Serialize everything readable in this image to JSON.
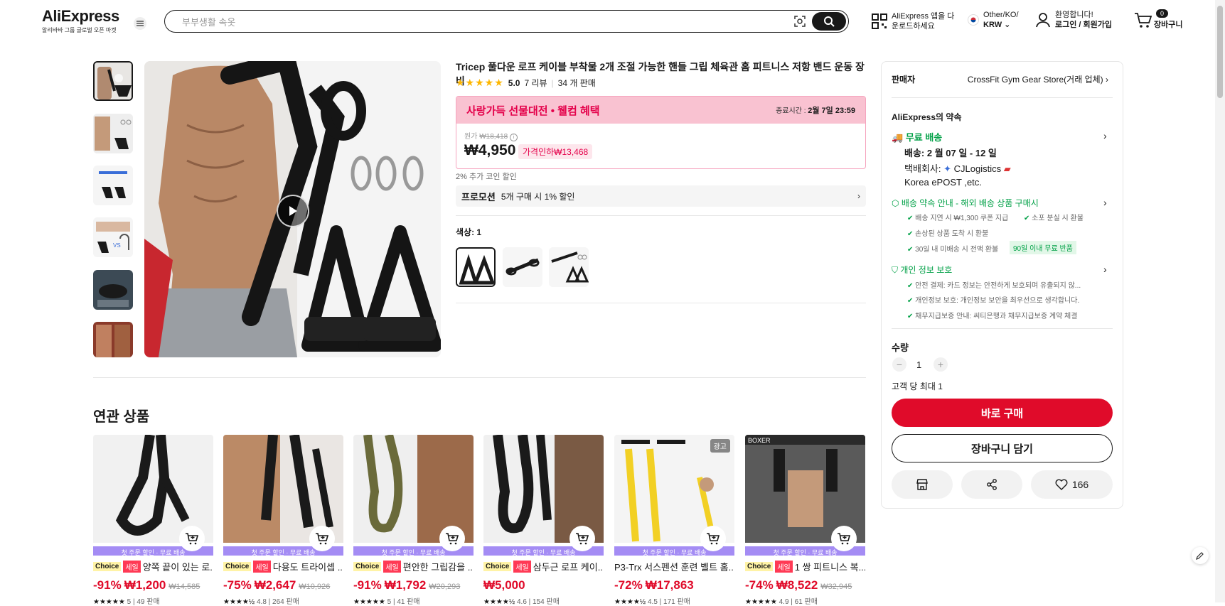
{
  "header": {
    "logo": "AliExpress",
    "logo_sub": "알리바바 그룹 글로벌 오픈 마켓",
    "search_placeholder": "부부생활 속옷",
    "app_line1": "AliExpress 앱을 다",
    "app_line2": "운로드하세요",
    "locale_line1": "Other/KO/",
    "locale_line2": "KRW",
    "user_line1": "환영합니다!",
    "user_line2": "로그인 / 회원가입",
    "cart_count": "0",
    "cart_label": "장바구니"
  },
  "product": {
    "title": "Tricep 풀다운 로프 케이블 부착물 2개 조절 가능한 핸들 그립 체육관 홈 피트니스 저항 밴드 운동 장비",
    "stars": "★★★★★",
    "rating": "5.0",
    "reviews": "7 리뷰",
    "sold": "34 개 판매",
    "promo_title": "사랑가득 선물대전 • 웰컴 혜택",
    "timer_label": "종료시간 :",
    "timer_value": "2월 7일 23:59",
    "original_label": "원가",
    "original_price": "₩18,418",
    "price": "₩4,950",
    "discount": "가격인하₩13,468",
    "coin": "2% 추가 코인 할인",
    "promotion_label": "프로모션",
    "promotion_text": "5개 구매 시 1% 할인",
    "color_label": "색상: 1"
  },
  "panel": {
    "seller_label": "판매자",
    "seller_name": "CrossFit Gym Gear Store(거래 업체)",
    "promise": "AliExpress의 약속",
    "free_ship": "무료 배송",
    "delivery": "배송: 2 월 07 일 - 12 일",
    "carrier_label": "택배회사:",
    "carrier_1": "CJLogistics",
    "carrier_2": "Korea",
    "carrier_3": "ePOST ,etc.",
    "guarantee_title": "배송 약속 안내 - 해외 배송 상품 구매시",
    "g1": "배송 지연 시 ₩1,300 쿠폰 지급",
    "g2": "소포 분실 시 환불",
    "g3": "손상된 상품 도착 시 환불",
    "g4": "30일 내 미배송 시 전액 환불",
    "g4_badge": "90일 이내 무료 반품",
    "privacy_title": "개인 정보 보호",
    "p1": "안전 결제: 카드 정보는 안전하게 보호되며 유출되지 않...",
    "p2": "개인정보 보호: 개인정보 보안을 최우선으로 생각합니다.",
    "p3": "채무지급보증 안내: 씨티은행과 채무지급보증 계약 체결",
    "qty_label": "수량",
    "qty_value": "1",
    "qty_limit": "고객 당 최대 1",
    "buy_now": "바로 구매",
    "add_cart": "장바구니 담기",
    "wish_count": "166"
  },
  "related": {
    "title": "연관 상품",
    "items": [
      {
        "strip": "첫 주문 할인 · 무료 배송",
        "choice": "Choice",
        "sale": "세일",
        "name": "양쪽 끝이 있는 로...",
        "discount": "-91%",
        "price": "₩1,200",
        "orig": "₩14,585",
        "stars": "★★★★★",
        "rating": "5",
        "sold": "49 판매"
      },
      {
        "strip": "첫 주문 할인 · 무료 배송",
        "choice": "Choice",
        "sale": "세일",
        "name": "다용도 트라이셉 ...",
        "discount": "-75%",
        "price": "₩2,647",
        "orig": "₩10,926",
        "stars": "★★★★½",
        "rating": "4.8",
        "sold": "264 판매"
      },
      {
        "strip": "첫 주문 할인 · 무료 배송",
        "choice": "Choice",
        "sale": "세일",
        "name": "편안한 그립감을 ...",
        "discount": "-91%",
        "price": "₩1,792",
        "orig": "₩20,293",
        "stars": "★★★★★",
        "rating": "5",
        "sold": "41 판매"
      },
      {
        "strip": "첫 주문 할인 · 무료 배송",
        "choice": "Choice",
        "sale": "세일",
        "name": "삼두근 로프 케이...",
        "discount": "",
        "price": "₩5,000",
        "orig": "",
        "stars": "★★★★½",
        "rating": "4.6",
        "sold": "154 판매"
      },
      {
        "strip": "첫 주문 할인 · 무료 배송",
        "choice": "",
        "sale": "",
        "name": "P3-Trx 서스펜션 훈련 벨트 홈...",
        "discount": "-72%",
        "price": "₩17,863",
        "orig": "",
        "stars": "★★★★½",
        "rating": "4.5",
        "sold": "171 판매",
        "ad": "광고"
      },
      {
        "strip": "첫 주문 할인 · 무료 배송",
        "choice": "Choice",
        "sale": "세일",
        "name": "1 쌍 피트니스 복...",
        "discount": "-74%",
        "price": "₩8,522",
        "orig": "₩32,945",
        "stars": "★★★★★",
        "rating": "4.9",
        "sold": "61 판매"
      }
    ]
  }
}
